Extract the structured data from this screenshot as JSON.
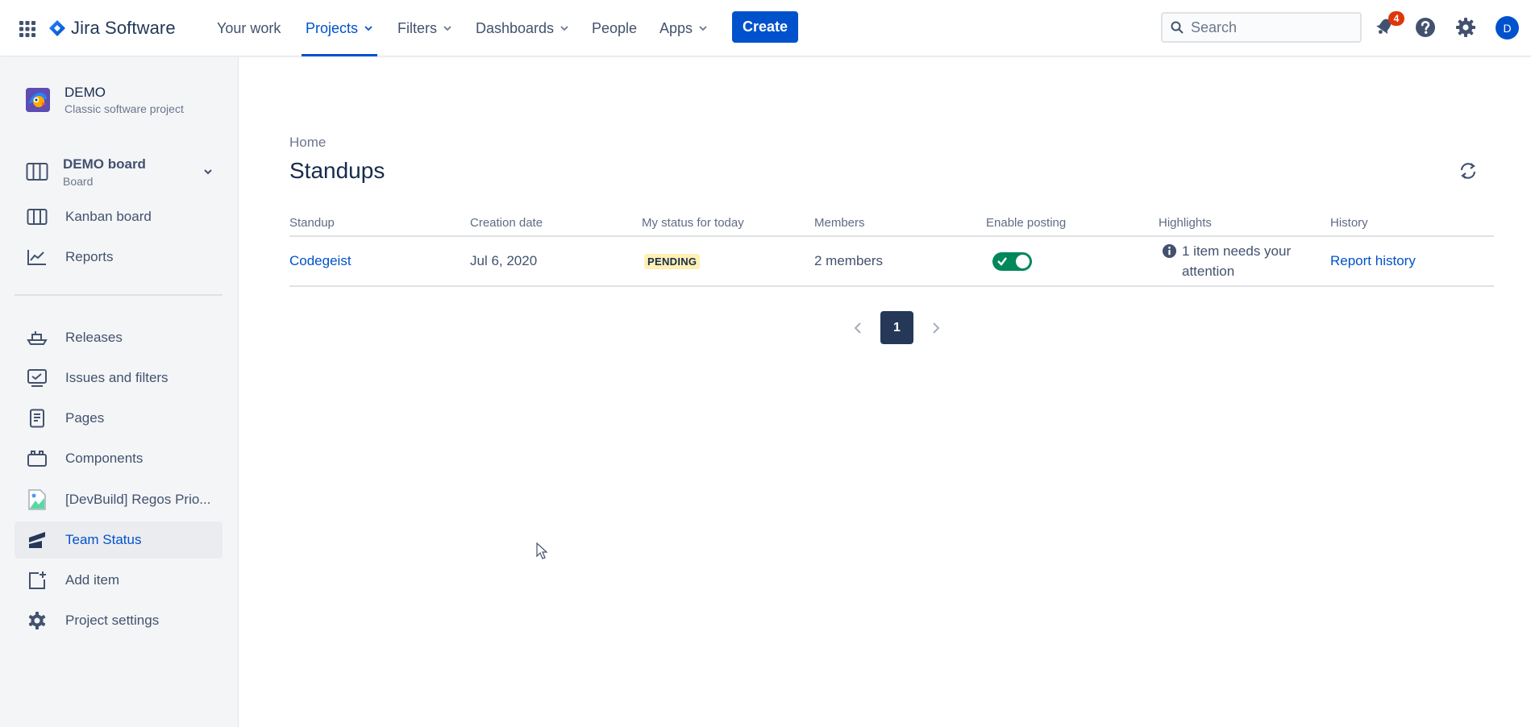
{
  "colors": {
    "brand": "#0052cc",
    "nav_text": "#42526e",
    "sidebar_bg": "#f4f5f7",
    "pending_bg": "#fff0b3",
    "toggle_on": "#00875a",
    "notification_badge": "#de350b"
  },
  "topnav": {
    "app_switcher_icon": "grid-icon",
    "product_name": "Jira Software",
    "items": [
      {
        "label": "Your work",
        "has_dropdown": false
      },
      {
        "label": "Projects",
        "has_dropdown": true,
        "active": true
      },
      {
        "label": "Filters",
        "has_dropdown": true
      },
      {
        "label": "Dashboards",
        "has_dropdown": true
      },
      {
        "label": "People",
        "has_dropdown": false
      },
      {
        "label": "Apps",
        "has_dropdown": true
      }
    ],
    "create_label": "Create",
    "search_placeholder": "Search",
    "notification_count": "4",
    "avatar_initial": "D"
  },
  "sidebar": {
    "project_name": "DEMO",
    "project_type": "Classic software project",
    "board_name": "DEMO board",
    "board_type": "Board",
    "items": [
      {
        "label": "Kanban board",
        "icon": "kanban-icon"
      },
      {
        "label": "Reports",
        "icon": "reports-icon"
      },
      {
        "label": "Releases",
        "icon": "ship-icon"
      },
      {
        "label": "Issues and filters",
        "icon": "issues-icon"
      },
      {
        "label": "Pages",
        "icon": "page-icon"
      },
      {
        "label": "Components",
        "icon": "components-icon"
      },
      {
        "label": "[DevBuild] Regos Prio...",
        "icon": "broken-image-icon"
      },
      {
        "label": "Team Status",
        "icon": "team-status-icon",
        "selected": true
      },
      {
        "label": "Add item",
        "icon": "add-item-icon"
      },
      {
        "label": "Project settings",
        "icon": "gear-icon"
      }
    ]
  },
  "main": {
    "breadcrumb": "Home",
    "title": "Standups",
    "table": {
      "headers": [
        "Standup",
        "Creation date",
        "My status for today",
        "Members",
        "Enable posting",
        "Highlights",
        "History"
      ],
      "rows": [
        {
          "standup": "Codegeist",
          "creation_date": "Jul 6, 2020",
          "status": "PENDING",
          "members": "2 members",
          "enable_posting": true,
          "highlight": "1 item needs your attention",
          "history": "Report history"
        }
      ]
    },
    "pagination": {
      "current_page": "1"
    }
  }
}
